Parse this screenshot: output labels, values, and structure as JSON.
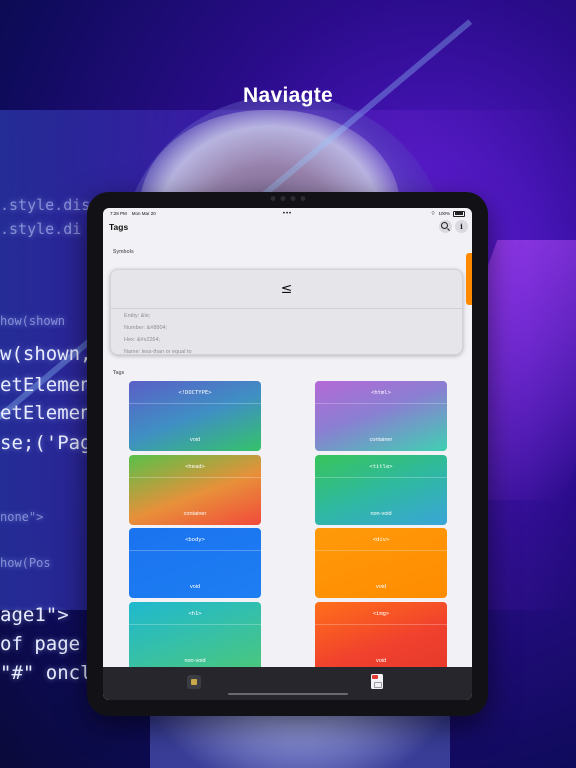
{
  "promo": {
    "title": "Naviagte"
  },
  "background_code": [
    ".style.dis",
    ".style.di",
    "how(shown",
    "w(shown,",
    "etElemen",
    "etElemen",
    "se;('Page",
    "none\">",
    "how(Pos",
    "age1\">",
    "of page",
    "\"#\" oncl"
  ],
  "status_bar": {
    "time": "7:28 PM",
    "date": "Mon Mar 20",
    "dots": "•••",
    "battery": "100%"
  },
  "nav": {
    "title": "Tags",
    "search_icon": "search-icon",
    "info_label": "i"
  },
  "symbols": {
    "section_label": "Symbols",
    "glyph": "≤",
    "entity": "Entity: &le;",
    "number": "Number: &#8804;",
    "hex": "Hex: &#x2264;",
    "name": "Name: less-than or equal to"
  },
  "tags": {
    "section_label": "Tags",
    "items": [
      {
        "name": "<!DOCTYPE>",
        "type": "void",
        "gradient": "linear-gradient(160deg, #5b5fc7 0%, #3f8fc4 50%, #35c26a 100%)"
      },
      {
        "name": "<html>",
        "type": "container",
        "gradient": "linear-gradient(160deg, #b469d6 0%, #8a7fd2 45%, #3fd0b2 100%)"
      },
      {
        "name": "<head>",
        "type": "container",
        "gradient": "linear-gradient(160deg, #57c14a 0%, #e8903a 55%, #f24a3a 100%)"
      },
      {
        "name": "<title>",
        "type": "non-void",
        "gradient": "linear-gradient(160deg, #38c45a 0%, #2fb9a0 50%, #3aa5d8 100%)"
      },
      {
        "name": "<body>",
        "type": "void",
        "gradient": "linear-gradient(160deg, #1a73f0 0%, #1e7ef2 100%)"
      },
      {
        "name": "<div>",
        "type": "void",
        "gradient": "linear-gradient(160deg, #ff9a0a 0%, #ff8c00 100%)"
      },
      {
        "name": "<h1>",
        "type": "non-void",
        "gradient": "linear-gradient(160deg, #1fb8cf 0%, #36c0a8 50%, #4bc77a 100%)"
      },
      {
        "name": "<img>",
        "type": "void",
        "gradient": "linear-gradient(160deg, #ff6f1a 0%, #f0402e 60%, #e63a2a 100%)"
      }
    ]
  },
  "tab_bar": {
    "tabs": [
      {
        "icon": "html-tag-icon"
      },
      {
        "icon": "html-file-icon"
      }
    ]
  }
}
